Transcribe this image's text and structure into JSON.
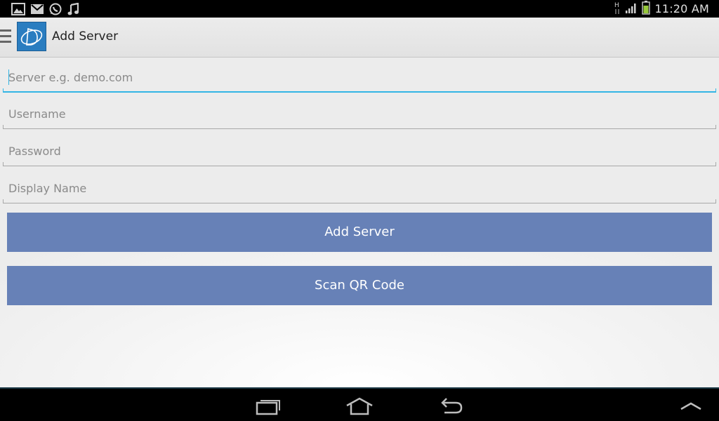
{
  "status_bar": {
    "time": "11:20 AM",
    "notification_icons": [
      "gallery-icon",
      "email-icon",
      "whatsapp-icon",
      "music-icon"
    ],
    "network_label": "H",
    "battery_color": "#98c93c"
  },
  "action_bar": {
    "title": "Add Server",
    "logo_color": "#2a7dc0"
  },
  "form": {
    "server": {
      "placeholder": "Server e.g. demo.com",
      "value": ""
    },
    "username": {
      "placeholder": "Username",
      "value": ""
    },
    "password": {
      "placeholder": "Password",
      "value": ""
    },
    "display_name": {
      "placeholder": "Display Name",
      "value": ""
    }
  },
  "buttons": {
    "add_server": "Add Server",
    "scan_qr": "Scan QR Code",
    "button_color": "#6781b7"
  },
  "colors": {
    "focus_accent": "#33b5e5"
  },
  "nav_bar": {
    "icons": [
      "recent-apps-icon",
      "home-icon",
      "back-icon",
      "menu-up-icon"
    ]
  }
}
